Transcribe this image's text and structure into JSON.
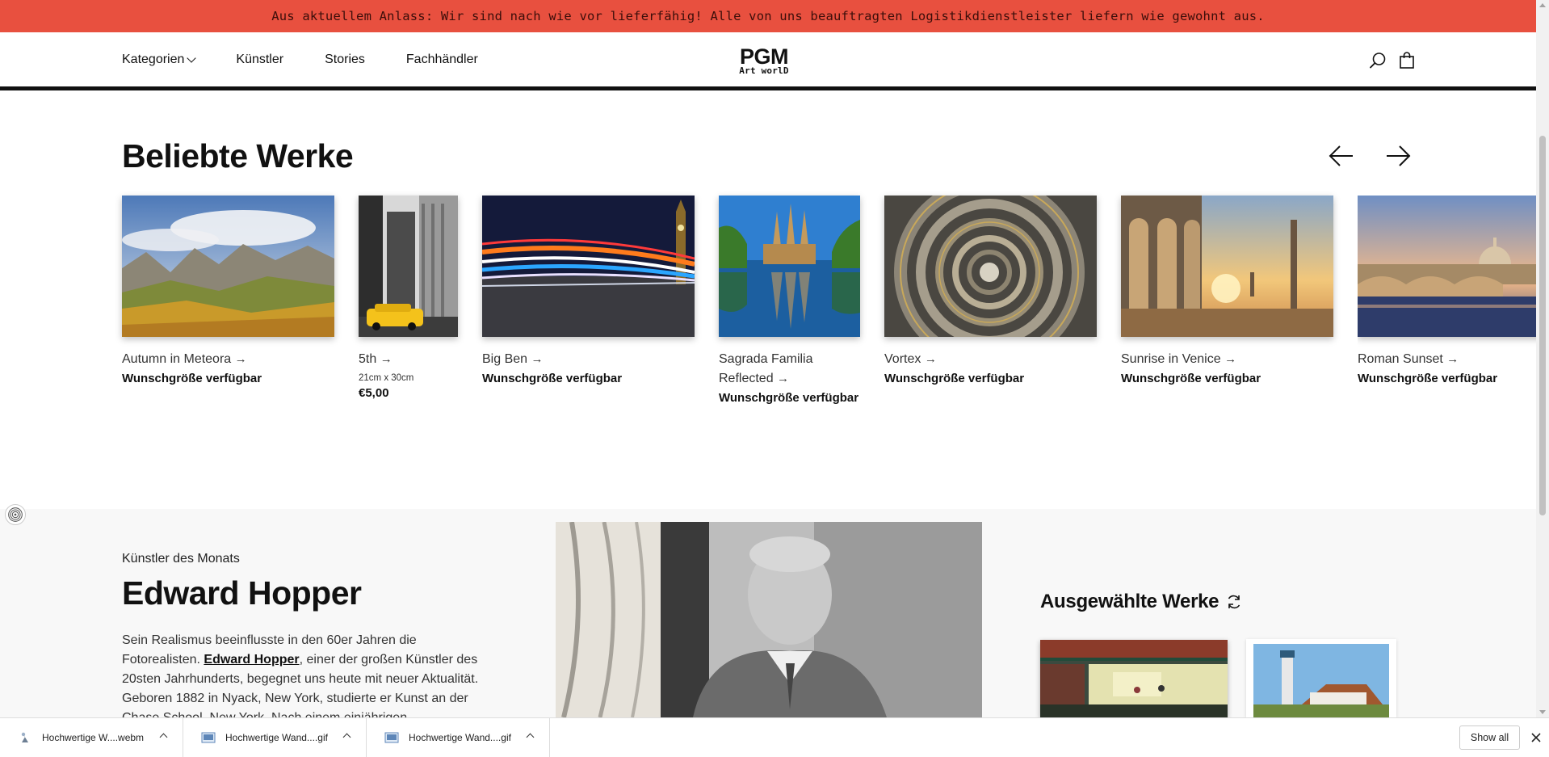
{
  "announcement": "Aus aktuellem Anlass: Wir sind nach wie vor lieferfähig! Alle von uns beauftragten Logistikdienstleister liefern wie gewohnt aus.",
  "header": {
    "nav": [
      {
        "label": "Kategorien"
      },
      {
        "label": "Künstler"
      },
      {
        "label": "Stories"
      },
      {
        "label": "Fachhändler"
      }
    ],
    "logo_top": "PGM",
    "logo_bottom": "Art worlD",
    "icons": [
      "search-icon",
      "shopping-bag-icon"
    ]
  },
  "popular": {
    "title": "Beliebte Werke",
    "arrow_icons": [
      "arrow-left-icon",
      "arrow-right-icon"
    ],
    "items": [
      {
        "title": "Autumn in Meteora",
        "arrow": "→",
        "sub": "Wunschgröße verfügbar"
      },
      {
        "title": "5th",
        "arrow": "→",
        "size": "21cm x 30cm",
        "price": "€5,00"
      },
      {
        "title": "Big Ben",
        "arrow": "→",
        "sub": "Wunschgröße verfügbar"
      },
      {
        "title": "Sagrada Familia Reflected",
        "arrow": "→",
        "sub": "Wunschgröße verfügbar"
      },
      {
        "title": "Vortex",
        "arrow": "→",
        "sub": "Wunschgröße verfügbar"
      },
      {
        "title": "Sunrise in Venice",
        "arrow": "→",
        "sub": "Wunschgröße verfügbar"
      },
      {
        "title": "Roman Sunset",
        "arrow": "→",
        "sub": "Wunschgröße verfügbar"
      }
    ]
  },
  "artist": {
    "label": "Künstler des Monats",
    "name": "Edward Hopper",
    "text_before": "Sein Realismus beeinflusste in den 60er Jahren die Fotorealisten. ",
    "link": "Edward Hopper",
    "text_after": ", einer der großen Künstler des 20sten Jahrhunderts, begegnet uns heute mit neuer Aktualität. Geboren 1882 in Nyack, New York, studierte er Kunst an der Chase School, New York. Nach einem einjährigen",
    "selected_title": "Ausgewählte Werke",
    "refresh_icon": "refresh-icon"
  },
  "downloads": {
    "items": [
      {
        "name": "Hochwertige W....webm",
        "icon": "video-file-icon"
      },
      {
        "name": "Hochwertige Wand....gif",
        "icon": "image-file-icon"
      },
      {
        "name": "Hochwertige Wand....gif",
        "icon": "image-file-icon"
      }
    ],
    "show_all": "Show all"
  },
  "colors": {
    "announcement_bg": "#e8503f",
    "text": "#111111"
  }
}
